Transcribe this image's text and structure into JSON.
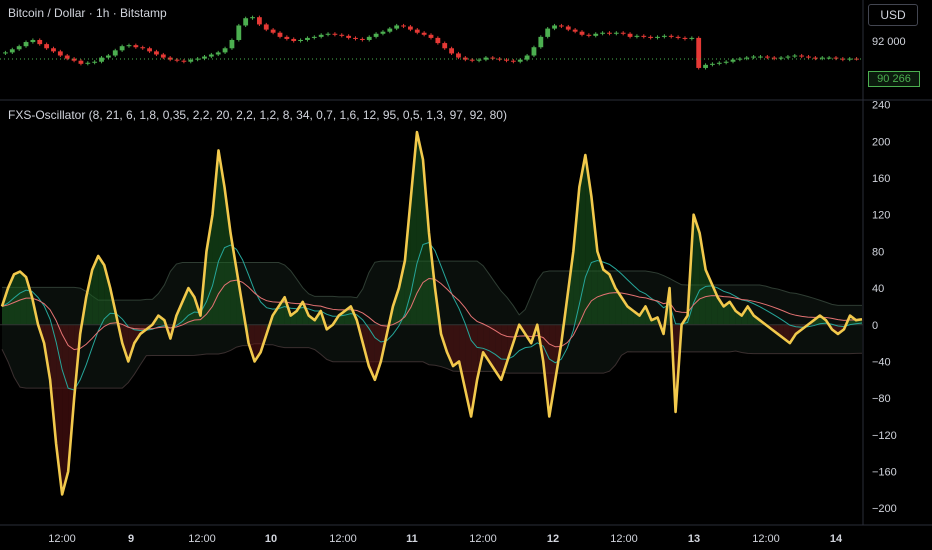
{
  "header": {
    "symbol_title": "Bitcoin / Dollar · 1h · Bitstamp",
    "currency": "USD",
    "last_price": "90 266",
    "price_tick": "92 000"
  },
  "indicator": {
    "title": "FXS-Oscillator (8, 21, 6, 1,8, 0,35, 2,2, 20, 2,2, 1,2, 8, 34, 0,7, 1,6, 12, 95, 0,5, 1,3, 97, 92, 80)"
  },
  "colors": {
    "background": "#000000",
    "oscillator": "#f2c94c",
    "candle_up": "#4caf50",
    "candle_down": "#e53935",
    "fast_line": "#26a69a",
    "slow_line": "#e57373",
    "band": "#3a3a3a",
    "price_tag": "#4caf50",
    "axis_text": "#d1d4dc",
    "grid": "#1a1a1a"
  },
  "chart_data": [
    {
      "type": "candlestick",
      "description_free": true,
      "ylim": [
        86500,
        94800
      ],
      "y_ticks": [
        92000
      ],
      "last_value": 90266,
      "closes": [
        90900,
        91200,
        91500,
        91900,
        92100,
        91700,
        91300,
        91000,
        90600,
        90300,
        90100,
        89800,
        89900,
        90000,
        90400,
        90600,
        91100,
        91500,
        91600,
        91400,
        91300,
        91000,
        90700,
        90400,
        90200,
        90100,
        90000,
        90200,
        90300,
        90500,
        90700,
        90900,
        91300,
        92100,
        93500,
        94200,
        94300,
        93600,
        93100,
        92800,
        92400,
        92200,
        92000,
        92100,
        92300,
        92400,
        92600,
        92700,
        92600,
        92500,
        92300,
        92200,
        92100,
        92400,
        92700,
        92900,
        93200,
        93500,
        93400,
        93100,
        92800,
        92600,
        92300,
        91800,
        91300,
        90800,
        90400,
        90200,
        90100,
        90200,
        90400,
        90300,
        90200,
        90100,
        90000,
        90200,
        90600,
        91400,
        92400,
        93200,
        93500,
        93400,
        93100,
        92900,
        92600,
        92500,
        92700,
        92800,
        92700,
        92800,
        92700,
        92400,
        92500,
        92400,
        92300,
        92400,
        92500,
        92400,
        92300,
        92200,
        92300,
        89400,
        89700,
        89800,
        89900,
        90000,
        90200,
        90300,
        90400,
        90500,
        90500,
        90400,
        90300,
        90400,
        90500,
        90600,
        90500,
        90400,
        90300,
        90400,
        90400,
        90300,
        90200,
        90300,
        90266
      ]
    },
    {
      "type": "line",
      "title": "FXS-Oscillator (8, 21, 6, 1,8, 0,35, 2,2, 20, 2,2, 1,2, 8, 34, 0,7, 1,6, 12, 95, 0,5, 1,3, 97, 92, 80)",
      "ylim": [
        -215,
        245
      ],
      "y_ticks": [
        240,
        200,
        160,
        120,
        80,
        40,
        0,
        -40,
        -80,
        -120,
        -160,
        -200
      ],
      "x_ticks": [
        "12:00",
        "9",
        "12:00",
        "10",
        "12:00",
        "11",
        "12:00",
        "12",
        "12:00",
        "13",
        "12:00",
        "14"
      ],
      "x_ticks_bold": [
        "9",
        "10",
        "11",
        "12",
        "13",
        "14"
      ],
      "grid": false,
      "series": [
        {
          "values": [
            20,
            40,
            55,
            58,
            52,
            30,
            0,
            -20,
            -60,
            -130,
            -185,
            -160,
            -80,
            -10,
            30,
            60,
            75,
            65,
            40,
            10,
            -20,
            -40,
            -20,
            -10,
            -5,
            0,
            10,
            5,
            -15,
            10,
            25,
            40,
            30,
            10,
            80,
            120,
            190,
            150,
            100,
            60,
            20,
            -20,
            -40,
            -30,
            -10,
            10,
            20,
            30,
            10,
            15,
            25,
            10,
            5,
            15,
            -5,
            0,
            10,
            15,
            20,
            5,
            -20,
            -45,
            -60,
            -40,
            -10,
            20,
            40,
            70,
            140,
            210,
            180,
            100,
            40,
            -10,
            -30,
            -45,
            -40,
            -70,
            -100,
            -60,
            -30,
            -40,
            -50,
            -60,
            -40,
            -20,
            0,
            -10,
            -20,
            0,
            -40,
            -100,
            -60,
            -20,
            30,
            80,
            150,
            185,
            140,
            80,
            60,
            55,
            40,
            30,
            20,
            15,
            10,
            20,
            5,
            8,
            -10,
            40,
            -95,
            0,
            10,
            120,
            100,
            60,
            45,
            30,
            20,
            25,
            15,
            10,
            20,
            10,
            5,
            0,
            -5,
            -10,
            -15,
            -20,
            -10,
            -5,
            0,
            5,
            10,
            5,
            -5,
            -10,
            -5,
            10,
            5,
            6
          ]
        }
      ]
    }
  ]
}
